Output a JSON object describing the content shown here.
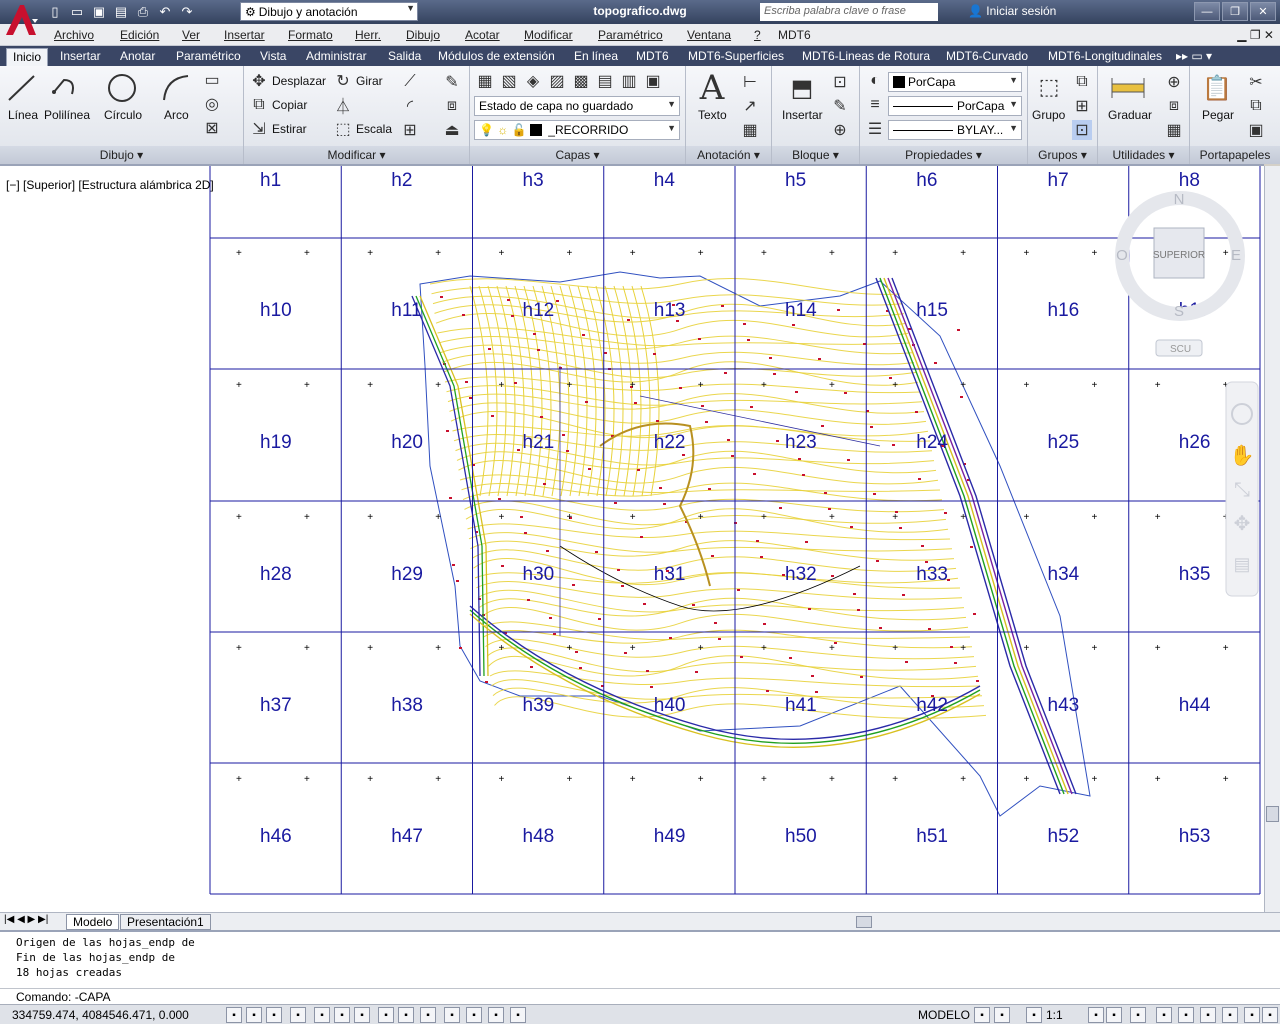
{
  "titlebar": {
    "workspace": "Dibujo y anotación",
    "document": "topografico.dwg",
    "search_placeholder": "Escriba palabra clave o frase",
    "signin": "Iniciar sesión"
  },
  "menu": [
    "Archivo",
    "Edición",
    "Ver",
    "Insertar",
    "Formato",
    "Herr.",
    "Dibujo",
    "Acotar",
    "Modificar",
    "Paramétrico",
    "Ventana",
    "?",
    "MDT6"
  ],
  "ribbon_tabs": [
    "Inicio",
    "Insertar",
    "Anotar",
    "Paramétrico",
    "Vista",
    "Administrar",
    "Salida",
    "Módulos de extensión",
    "En línea",
    "MDT6",
    "MDT6-Superficies",
    "MDT6-Lineas de Rotura",
    "MDT6-Curvado",
    "MDT6-Longitudinales"
  ],
  "panels": {
    "dibujo": {
      "title": "Dibujo",
      "linea": "Línea",
      "polilinea": "Polilínea",
      "circulo": "Círculo",
      "arco": "Arco"
    },
    "modificar": {
      "title": "Modificar",
      "desplazar": "Desplazar",
      "girar": "Girar",
      "copiar": "Copiar",
      "estirar": "Estirar",
      "escala": "Escala"
    },
    "capas": {
      "title": "Capas",
      "state": "Estado de capa no guardado",
      "layer": "_RECORRIDO"
    },
    "anotacion": {
      "title": "Anotación",
      "texto": "Texto"
    },
    "bloque": {
      "title": "Bloque",
      "insertar": "Insertar"
    },
    "propiedades": {
      "title": "Propiedades",
      "color": "PorCapa",
      "linetype": "PorCapa",
      "lineweight": "BYLAY..."
    },
    "grupos": {
      "title": "Grupos",
      "grupo": "Grupo"
    },
    "utilidades": {
      "title": "Utilidades",
      "graduar": "Graduar"
    },
    "portapapeles": {
      "title": "Portapapeles",
      "pegar": "Pegar"
    }
  },
  "viewport_label": "[−] [Superior] [Estructura alámbrica 2D]",
  "viewcube": {
    "top": "SUPERIOR",
    "n": "N",
    "s": "S",
    "e": "E",
    "w": "O",
    "ucs": "SCU"
  },
  "sheets": [
    [
      "h1",
      "h2",
      "h3",
      "h4",
      "h5",
      "h6",
      "h7",
      "h8"
    ],
    [
      "h10",
      "h11",
      "h12",
      "h13",
      "h14",
      "h15",
      "h16",
      "h17"
    ],
    [
      "h19",
      "h20",
      "h21",
      "h22",
      "h23",
      "h24",
      "h25",
      "h26"
    ],
    [
      "h28",
      "h29",
      "h30",
      "h31",
      "h32",
      "h33",
      "h34",
      "h35"
    ],
    [
      "h37",
      "h38",
      "h39",
      "h40",
      "h41",
      "h42",
      "h43",
      "h44"
    ],
    [
      "h46",
      "h47",
      "h48",
      "h49",
      "h50",
      "h51",
      "h52",
      "h53"
    ]
  ],
  "layout_tabs": [
    "Modelo",
    "Presentación1"
  ],
  "command_history": [
    "Origen de las hojas_endp de",
    "Fin de las hojas_endp de",
    "18 hojas creadas"
  ],
  "command_prompt": "Comando: -CAPA",
  "status": {
    "coords": "334759.474, 4084546.471, 0.000",
    "space": "MODELO",
    "scale": "1:1"
  },
  "colors": {
    "grid": "#1a1aa0",
    "contour": "#e8d23a",
    "road": "#2a2aa8",
    "accent": "#c8102e"
  }
}
